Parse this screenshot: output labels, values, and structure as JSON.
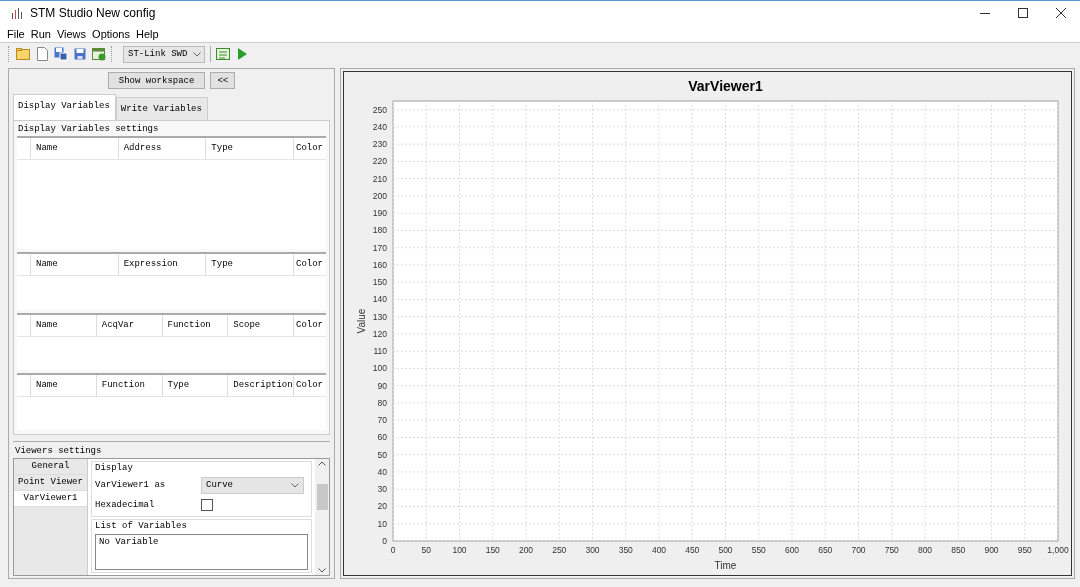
{
  "window": {
    "title": "STM Studio New config"
  },
  "menu": [
    "File",
    "Run",
    "Views",
    "Options",
    "Help"
  ],
  "toolbar": {
    "probe": "ST-Link SWD"
  },
  "workspace_button": "Show workspace",
  "collapse_button": "<<",
  "tabs": [
    {
      "label": "Display Variables",
      "selected": true
    },
    {
      "label": "Write Variables",
      "selected": false
    }
  ],
  "settings_title": "Display Variables settings",
  "tables": [
    {
      "columns": [
        "Name",
        "Address",
        "Type",
        "Color"
      ]
    },
    {
      "columns": [
        "Name",
        "Expression",
        "Type",
        "Color"
      ]
    },
    {
      "columns": [
        "Name",
        "AcqVar",
        "Function",
        "Scope",
        "Color"
      ]
    },
    {
      "columns": [
        "Name",
        "Function",
        "Type",
        "Description",
        "Color"
      ]
    }
  ],
  "viewers": {
    "title": "Viewers settings",
    "items": [
      {
        "label": "General",
        "selected": false
      },
      {
        "label": "Point Viewer",
        "selected": false
      },
      {
        "label": "VarViewer1",
        "selected": true
      }
    ],
    "display_title": "Display",
    "display_as_label": "VarViewer1 as",
    "display_as_value": "Curve",
    "hexadecimal": {
      "label": "Hexadecimal",
      "checked": false
    },
    "list_title": "List of Variables",
    "list_items": [
      "No Variable"
    ]
  },
  "chart": {
    "chart_data": {
      "type": "line",
      "title": "VarViewer1",
      "xlabel": "Time",
      "ylabel": "Value",
      "xlim": [
        0,
        1000
      ],
      "ylim": [
        0,
        255
      ],
      "xticks": [
        0,
        50,
        100,
        150,
        200,
        250,
        300,
        350,
        400,
        450,
        500,
        550,
        600,
        650,
        700,
        750,
        800,
        850,
        900,
        950,
        {
          "value": 1000,
          "label": "1,000"
        }
      ],
      "grid": true,
      "yticks": [
        0,
        10,
        20,
        30,
        40,
        50,
        60,
        70,
        80,
        90,
        100,
        110,
        120,
        130,
        140,
        150,
        160,
        170,
        180,
        190,
        200,
        210,
        220,
        230,
        240,
        250
      ]
    }
  }
}
